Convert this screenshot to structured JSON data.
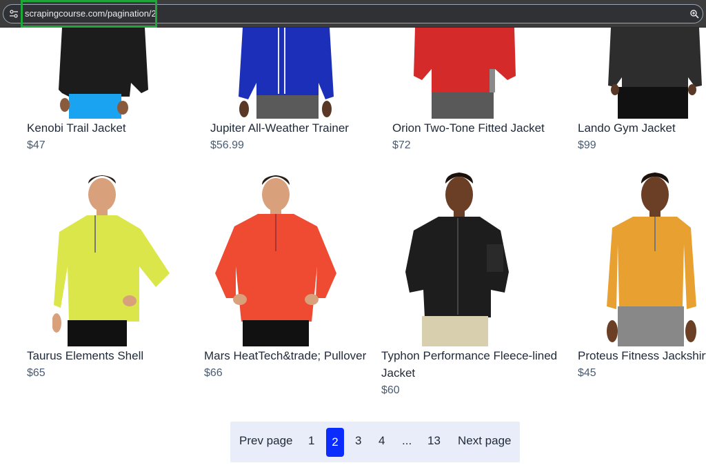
{
  "browser": {
    "url": "scrapingcourse.com/pagination/2"
  },
  "products": [
    {
      "name": "Kenobi Trail Jacket",
      "price": "$47"
    },
    {
      "name": "Jupiter All-Weather Trainer",
      "price": "$56.99"
    },
    {
      "name": "Orion Two-Tone Fitted Jacket",
      "price": "$72"
    },
    {
      "name": "Lando Gym Jacket",
      "price": "$99"
    },
    {
      "name": "Taurus Elements Shell",
      "price": "$65"
    },
    {
      "name": "Mars HeatTech&trade; Pullover",
      "price": "$66"
    },
    {
      "name_line1": "Typhon Performance Fleece-lined",
      "name_line2": "Jacket",
      "price": "$60"
    },
    {
      "name": "Proteus Fitness Jackshirt",
      "price": "$45"
    }
  ],
  "pagination": {
    "prev": "Prev page",
    "pages": [
      "1",
      "2",
      "3",
      "4",
      "...",
      "13"
    ],
    "current": "2",
    "next": "Next page"
  },
  "colors": {
    "active_page": "#0a2cff",
    "pager_bg": "#e9edfa",
    "highlight_box": "#1fa83a"
  }
}
